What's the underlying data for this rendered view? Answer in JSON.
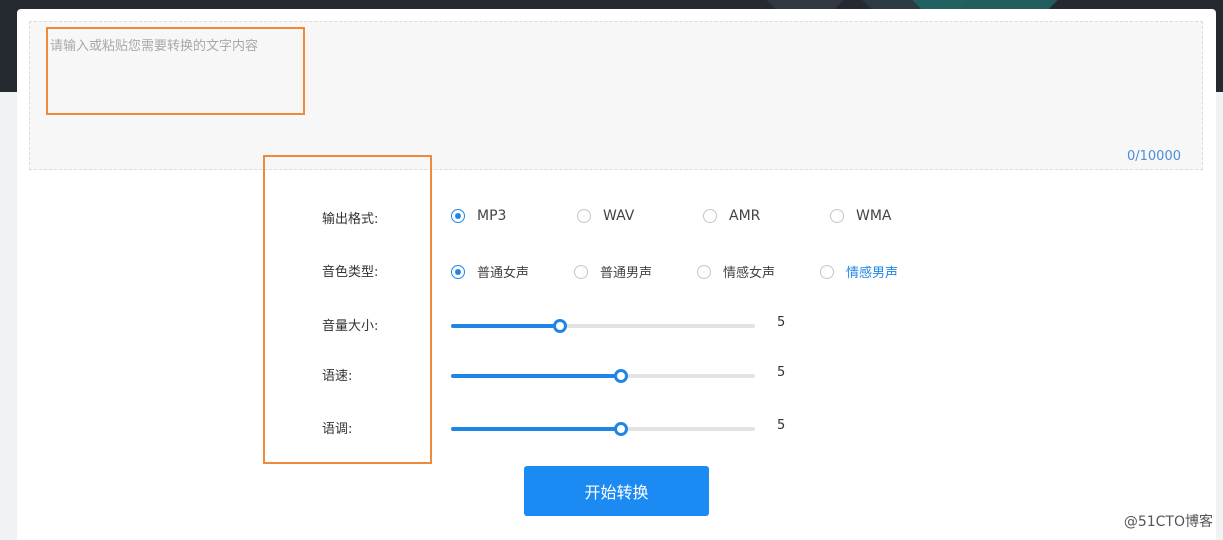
{
  "input": {
    "placeholder": "请输入或粘贴您需要转换的文字内容",
    "value": "",
    "counter": "0/10000"
  },
  "format": {
    "label": "输出格式:",
    "options": [
      "MP3",
      "WAV",
      "AMR",
      "WMA"
    ],
    "selected": "MP3"
  },
  "voice": {
    "label": "音色类型:",
    "options": [
      "普通女声",
      "普通男声",
      "情感女声",
      "情感男声"
    ],
    "selected": "普通女声"
  },
  "sliders": [
    {
      "label": "音量大小:",
      "value": "5",
      "level": 0.36
    },
    {
      "label": "语速:",
      "value": "5",
      "level": 0.56
    },
    {
      "label": "语调:",
      "value": "5",
      "level": 0.56
    }
  ],
  "start_button": "开始转换",
  "watermark": "@51CTO博客",
  "colors": {
    "accent": "#1f86e8",
    "highlight": "#ef8a3a",
    "header": "#252a31"
  }
}
